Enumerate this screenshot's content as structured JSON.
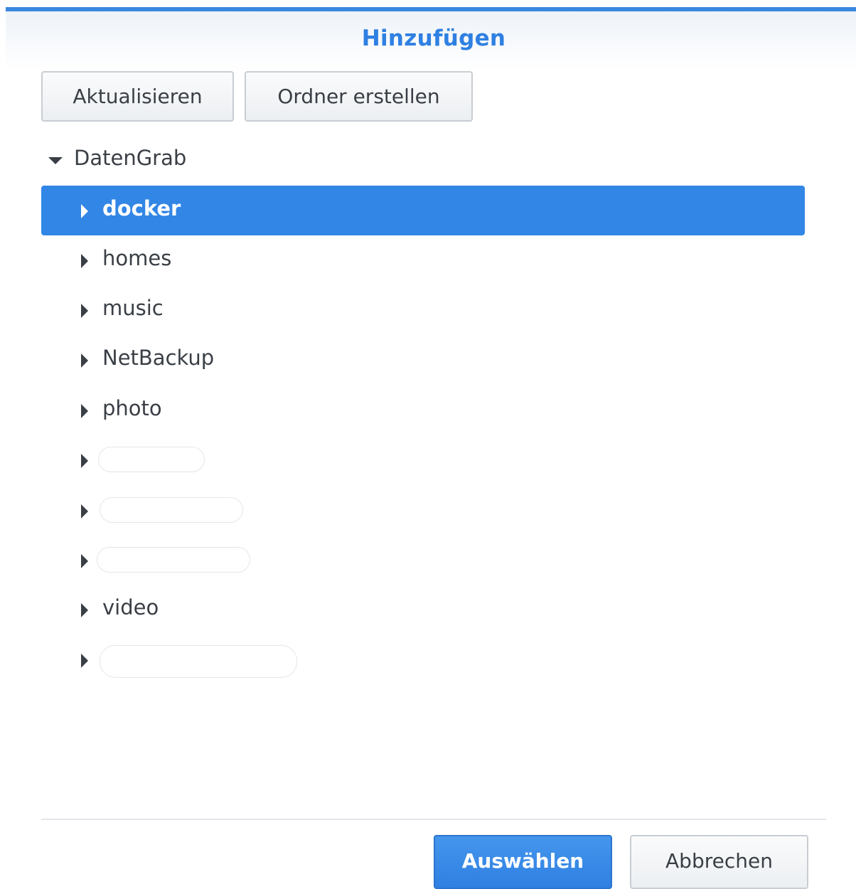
{
  "dialog": {
    "title": "Hinzufügen"
  },
  "toolbar": {
    "refresh_label": "Aktualisieren",
    "create_folder_label": "Ordner erstellen"
  },
  "tree": {
    "root_label": "DatenGrab",
    "items": [
      {
        "label": "docker",
        "selected": true
      },
      {
        "label": "homes"
      },
      {
        "label": "music"
      },
      {
        "label": "NetBackup"
      },
      {
        "label": "photo"
      },
      {
        "label": ""
      },
      {
        "label": ""
      },
      {
        "label": ""
      },
      {
        "label": "video"
      },
      {
        "label": ""
      }
    ]
  },
  "footer": {
    "select_label": "Auswählen",
    "cancel_label": "Abbrechen"
  },
  "colors": {
    "accent": "#3286e6",
    "title": "#2f80e2"
  }
}
